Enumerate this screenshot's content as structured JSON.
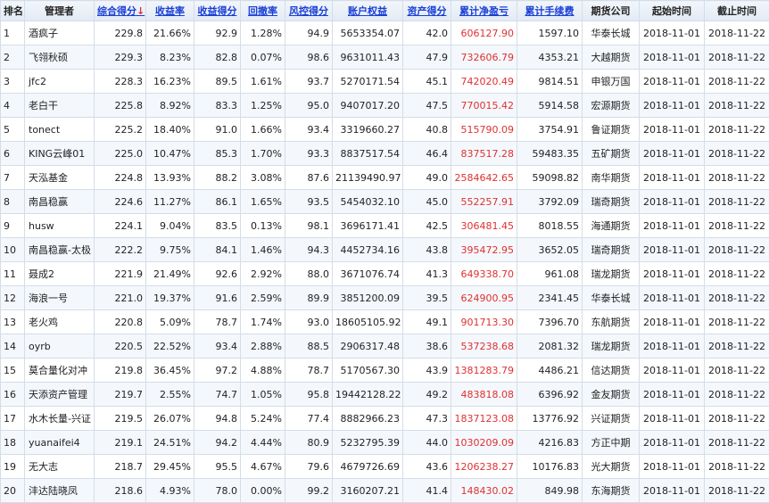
{
  "headers": {
    "rank": "排名",
    "manager": "管理者",
    "composite": "综合得分",
    "composite_arrow": "↓",
    "return_rate": "收益率",
    "return_score": "收益得分",
    "drawdown": "回撤率",
    "risk_score": "风控得分",
    "equity": "账户权益",
    "asset_score": "资产得分",
    "net_pnl": "累计净盈亏",
    "fees": "累计手续费",
    "broker": "期货公司",
    "start": "起始时间",
    "end": "截止时间"
  },
  "rows": [
    {
      "rank": "1",
      "manager": "酒疯子",
      "composite": "229.8",
      "return_rate": "21.66%",
      "return_score": "92.9",
      "drawdown": "1.28%",
      "risk_score": "94.9",
      "equity": "5653354.07",
      "asset_score": "42.0",
      "net_pnl": "606127.90",
      "fees": "1597.10",
      "broker": "华泰长城",
      "start": "2018-11-01",
      "end": "2018-11-22"
    },
    {
      "rank": "2",
      "manager": "飞翎秋硕",
      "composite": "229.3",
      "return_rate": "8.23%",
      "return_score": "82.8",
      "drawdown": "0.07%",
      "risk_score": "98.6",
      "equity": "9631011.43",
      "asset_score": "47.9",
      "net_pnl": "732606.79",
      "fees": "4353.21",
      "broker": "大越期货",
      "start": "2018-11-01",
      "end": "2018-11-22"
    },
    {
      "rank": "3",
      "manager": "jfc2",
      "composite": "228.3",
      "return_rate": "16.23%",
      "return_score": "89.5",
      "drawdown": "1.61%",
      "risk_score": "93.7",
      "equity": "5270171.54",
      "asset_score": "45.1",
      "net_pnl": "742020.49",
      "fees": "9814.51",
      "broker": "申银万国",
      "start": "2018-11-01",
      "end": "2018-11-22"
    },
    {
      "rank": "4",
      "manager": "老白干",
      "composite": "225.8",
      "return_rate": "8.92%",
      "return_score": "83.3",
      "drawdown": "1.25%",
      "risk_score": "95.0",
      "equity": "9407017.20",
      "asset_score": "47.5",
      "net_pnl": "770015.42",
      "fees": "5914.58",
      "broker": "宏源期货",
      "start": "2018-11-01",
      "end": "2018-11-22"
    },
    {
      "rank": "5",
      "manager": "tonect",
      "composite": "225.2",
      "return_rate": "18.40%",
      "return_score": "91.0",
      "drawdown": "1.66%",
      "risk_score": "93.4",
      "equity": "3319660.27",
      "asset_score": "40.8",
      "net_pnl": "515790.09",
      "fees": "3754.91",
      "broker": "鲁证期货",
      "start": "2018-11-01",
      "end": "2018-11-22"
    },
    {
      "rank": "6",
      "manager": "KING云峰01",
      "composite": "225.0",
      "return_rate": "10.47%",
      "return_score": "85.3",
      "drawdown": "1.70%",
      "risk_score": "93.3",
      "equity": "8837517.54",
      "asset_score": "46.4",
      "net_pnl": "837517.28",
      "fees": "59483.35",
      "broker": "五矿期货",
      "start": "2018-11-01",
      "end": "2018-11-22"
    },
    {
      "rank": "7",
      "manager": "天泓基金",
      "composite": "224.8",
      "return_rate": "13.93%",
      "return_score": "88.2",
      "drawdown": "3.08%",
      "risk_score": "87.6",
      "equity": "21139490.97",
      "asset_score": "49.0",
      "net_pnl": "2584642.65",
      "fees": "59098.82",
      "broker": "南华期货",
      "start": "2018-11-01",
      "end": "2018-11-22"
    },
    {
      "rank": "8",
      "manager": "南昌稳赢",
      "composite": "224.6",
      "return_rate": "11.27%",
      "return_score": "86.1",
      "drawdown": "1.65%",
      "risk_score": "93.5",
      "equity": "5454032.10",
      "asset_score": "45.0",
      "net_pnl": "552257.91",
      "fees": "3792.09",
      "broker": "瑞奇期货",
      "start": "2018-11-01",
      "end": "2018-11-22"
    },
    {
      "rank": "9",
      "manager": "husw",
      "composite": "224.1",
      "return_rate": "9.04%",
      "return_score": "83.5",
      "drawdown": "0.13%",
      "risk_score": "98.1",
      "equity": "3696171.41",
      "asset_score": "42.5",
      "net_pnl": "306481.45",
      "fees": "8018.55",
      "broker": "海通期货",
      "start": "2018-11-01",
      "end": "2018-11-22"
    },
    {
      "rank": "10",
      "manager": "南昌稳赢-太极",
      "composite": "222.2",
      "return_rate": "9.75%",
      "return_score": "84.1",
      "drawdown": "1.46%",
      "risk_score": "94.3",
      "equity": "4452734.16",
      "asset_score": "43.8",
      "net_pnl": "395472.95",
      "fees": "3652.05",
      "broker": "瑞奇期货",
      "start": "2018-11-01",
      "end": "2018-11-22"
    },
    {
      "rank": "11",
      "manager": "聂成2",
      "composite": "221.9",
      "return_rate": "21.49%",
      "return_score": "92.6",
      "drawdown": "2.92%",
      "risk_score": "88.0",
      "equity": "3671076.74",
      "asset_score": "41.3",
      "net_pnl": "649338.70",
      "fees": "961.08",
      "broker": "瑞龙期货",
      "start": "2018-11-01",
      "end": "2018-11-22"
    },
    {
      "rank": "12",
      "manager": "海浪一号",
      "composite": "221.0",
      "return_rate": "19.37%",
      "return_score": "91.6",
      "drawdown": "2.59%",
      "risk_score": "89.9",
      "equity": "3851200.09",
      "asset_score": "39.5",
      "net_pnl": "624900.95",
      "fees": "2341.45",
      "broker": "华泰长城",
      "start": "2018-11-01",
      "end": "2018-11-22"
    },
    {
      "rank": "13",
      "manager": "老火鸡",
      "composite": "220.8",
      "return_rate": "5.09%",
      "return_score": "78.7",
      "drawdown": "1.74%",
      "risk_score": "93.0",
      "equity": "18605105.92",
      "asset_score": "49.1",
      "net_pnl": "901713.30",
      "fees": "7396.70",
      "broker": "东航期货",
      "start": "2018-11-01",
      "end": "2018-11-22"
    },
    {
      "rank": "14",
      "manager": "oyrb",
      "composite": "220.5",
      "return_rate": "22.52%",
      "return_score": "93.4",
      "drawdown": "2.88%",
      "risk_score": "88.5",
      "equity": "2906317.48",
      "asset_score": "38.6",
      "net_pnl": "537238.68",
      "fees": "2081.32",
      "broker": "瑞龙期货",
      "start": "2018-11-01",
      "end": "2018-11-22"
    },
    {
      "rank": "15",
      "manager": "莫合量化对冲",
      "composite": "219.8",
      "return_rate": "36.45%",
      "return_score": "97.2",
      "drawdown": "4.88%",
      "risk_score": "78.7",
      "equity": "5170567.30",
      "asset_score": "43.9",
      "net_pnl": "1381283.79",
      "fees": "4486.21",
      "broker": "信达期货",
      "start": "2018-11-01",
      "end": "2018-11-22"
    },
    {
      "rank": "16",
      "manager": "天添资产管理",
      "composite": "219.7",
      "return_rate": "2.55%",
      "return_score": "74.7",
      "drawdown": "1.05%",
      "risk_score": "95.8",
      "equity": "19442128.22",
      "asset_score": "49.2",
      "net_pnl": "483818.08",
      "fees": "6396.92",
      "broker": "金友期货",
      "start": "2018-11-01",
      "end": "2018-11-22"
    },
    {
      "rank": "17",
      "manager": "水木长量-兴证",
      "composite": "219.5",
      "return_rate": "26.07%",
      "return_score": "94.8",
      "drawdown": "5.24%",
      "risk_score": "77.4",
      "equity": "8882966.23",
      "asset_score": "47.3",
      "net_pnl": "1837123.08",
      "fees": "13776.92",
      "broker": "兴证期货",
      "start": "2018-11-01",
      "end": "2018-11-22"
    },
    {
      "rank": "18",
      "manager": "yuanaifei4",
      "composite": "219.1",
      "return_rate": "24.51%",
      "return_score": "94.2",
      "drawdown": "4.44%",
      "risk_score": "80.9",
      "equity": "5232795.39",
      "asset_score": "44.0",
      "net_pnl": "1030209.09",
      "fees": "4216.83",
      "broker": "方正中期",
      "start": "2018-11-01",
      "end": "2018-11-22"
    },
    {
      "rank": "19",
      "manager": "无大志",
      "composite": "218.7",
      "return_rate": "29.45%",
      "return_score": "95.5",
      "drawdown": "4.67%",
      "risk_score": "79.6",
      "equity": "4679726.69",
      "asset_score": "43.6",
      "net_pnl": "1206238.27",
      "fees": "10176.83",
      "broker": "光大期货",
      "start": "2018-11-01",
      "end": "2018-11-22"
    },
    {
      "rank": "20",
      "manager": "沣达陆晓凤",
      "composite": "218.6",
      "return_rate": "4.93%",
      "return_score": "78.0",
      "drawdown": "0.00%",
      "risk_score": "99.2",
      "equity": "3160207.21",
      "asset_score": "41.4",
      "net_pnl": "148430.02",
      "fees": "849.98",
      "broker": "东海期货",
      "start": "2018-11-01",
      "end": "2018-11-22"
    }
  ]
}
